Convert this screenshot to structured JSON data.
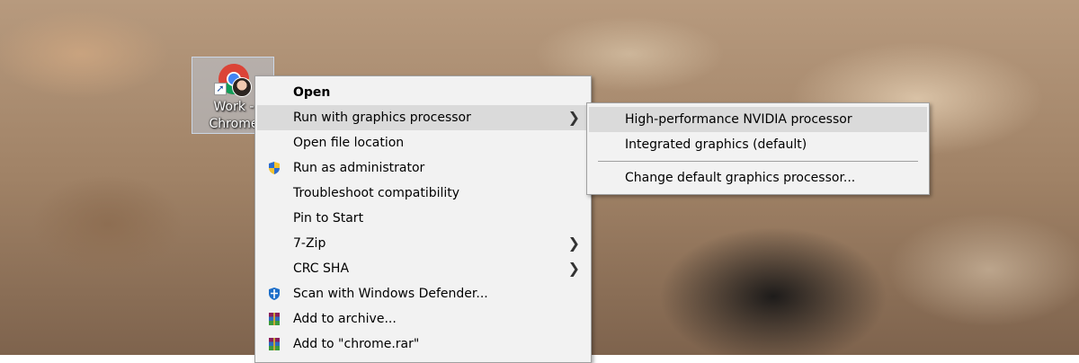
{
  "desktop_icon": {
    "label": "Work -\nChrome"
  },
  "context_menu": {
    "items": [
      {
        "label": "Open",
        "bold": true,
        "icon": "",
        "submenu": false,
        "highlighted": false
      },
      {
        "label": "Run with graphics processor",
        "bold": false,
        "icon": "",
        "submenu": true,
        "highlighted": true
      },
      {
        "label": "Open file location",
        "bold": false,
        "icon": "",
        "submenu": false,
        "highlighted": false
      },
      {
        "label": "Run as administrator",
        "bold": false,
        "icon": "uac-shield-icon",
        "submenu": false,
        "highlighted": false
      },
      {
        "label": "Troubleshoot compatibility",
        "bold": false,
        "icon": "",
        "submenu": false,
        "highlighted": false
      },
      {
        "label": "Pin to Start",
        "bold": false,
        "icon": "",
        "submenu": false,
        "highlighted": false
      },
      {
        "label": "7-Zip",
        "bold": false,
        "icon": "",
        "submenu": true,
        "highlighted": false
      },
      {
        "label": "CRC SHA",
        "bold": false,
        "icon": "",
        "submenu": true,
        "highlighted": false
      },
      {
        "label": "Scan with Windows Defender...",
        "bold": false,
        "icon": "defender-icon",
        "submenu": false,
        "highlighted": false
      },
      {
        "label": "Add to archive...",
        "bold": false,
        "icon": "winrar-icon",
        "submenu": false,
        "highlighted": false
      },
      {
        "label": "Add to \"chrome.rar\"",
        "bold": false,
        "icon": "winrar-icon",
        "submenu": false,
        "highlighted": false
      }
    ],
    "arrow_glyph": "❯"
  },
  "graphics_submenu": {
    "items": [
      {
        "label": "High-performance NVIDIA processor",
        "highlighted": true
      },
      {
        "label": "Integrated graphics (default)",
        "highlighted": false
      },
      {
        "label": "Change default graphics processor...",
        "highlighted": false
      }
    ]
  },
  "colors": {
    "menu_bg": "#f2f2f2",
    "menu_highlight": "#dadada",
    "menu_border": "#a0a0a0"
  }
}
